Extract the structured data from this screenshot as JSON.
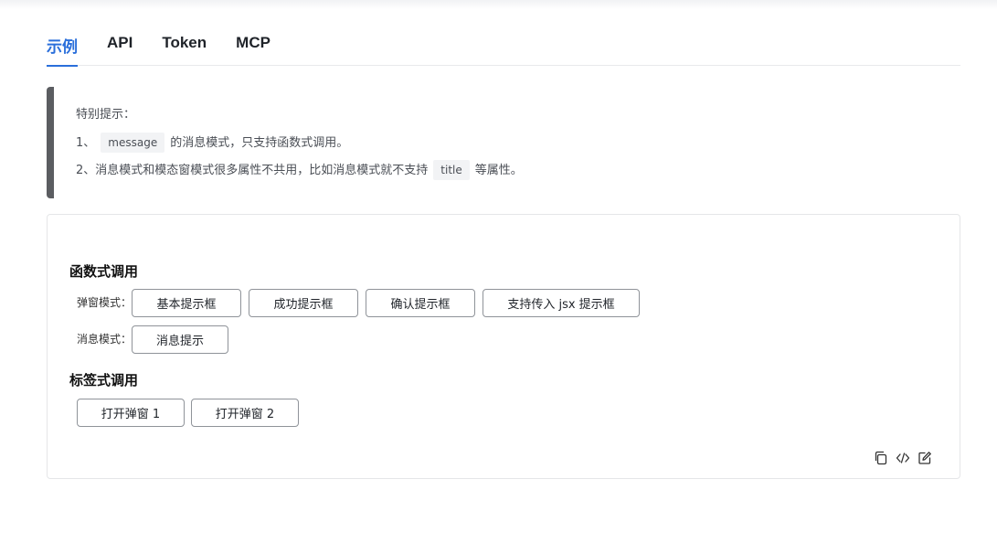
{
  "tabs": [
    {
      "label": "示例",
      "active": true
    },
    {
      "label": "API",
      "active": false
    },
    {
      "label": "Token",
      "active": false
    },
    {
      "label": "MCP",
      "active": false
    }
  ],
  "notice": {
    "title": "特别提示：",
    "line1_prefix": "1、",
    "line1_code": "message",
    "line1_suffix": "的消息模式，只支持函数式调用。",
    "line2_prefix": "2、消息模式和模态窗模式很多属性不共用，比如消息模式就不支持",
    "line2_code": "title",
    "line2_suffix": "等属性。"
  },
  "demo": {
    "functional_title": "函数式调用",
    "modal_label": "弹窗模式：",
    "modal_buttons": [
      "基本提示框",
      "成功提示框",
      "确认提示框",
      "支持传入 jsx 提示框"
    ],
    "message_label": "消息模式：",
    "message_button": "消息提示",
    "tag_title": "标签式调用",
    "tag_buttons": [
      "打开弹窗 1",
      "打开弹窗 2"
    ]
  },
  "toolbar": {
    "icons": [
      "copy-icon",
      "code-icon",
      "edit-icon"
    ]
  },
  "colors": {
    "accent": "#2a6fdb",
    "notice_bar": "#5b5d61",
    "border": "#e5e6e8"
  }
}
